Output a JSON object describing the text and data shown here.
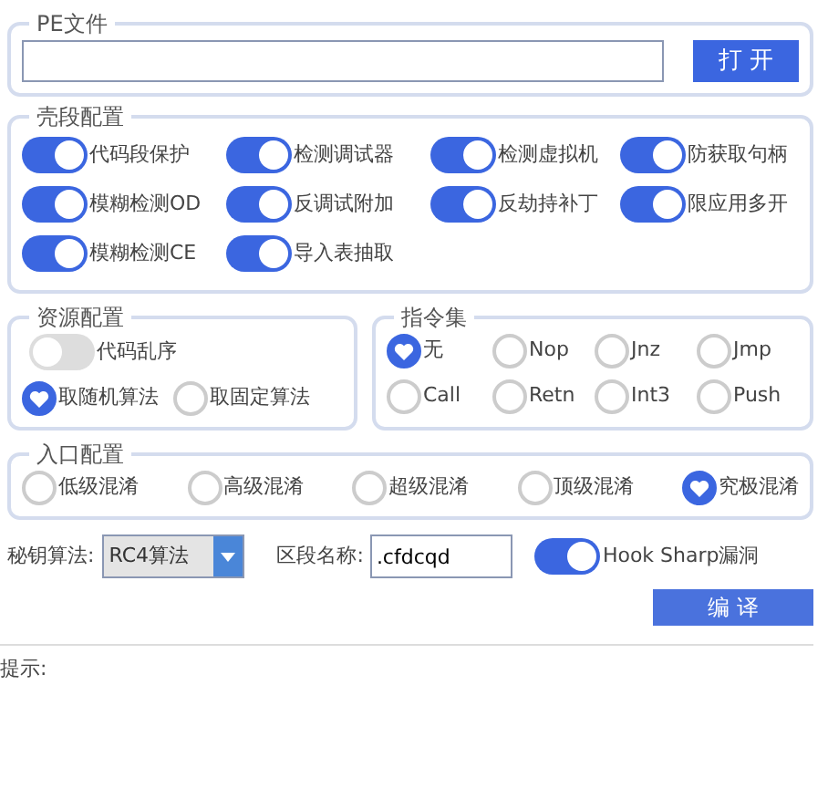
{
  "pe_file": {
    "legend": "PE文件",
    "button": "打 开"
  },
  "shell_config": {
    "legend": "壳段配置",
    "options": [
      {
        "label": "代码段保护",
        "on": true
      },
      {
        "label": "检测调试器",
        "on": true
      },
      {
        "label": "检测虚拟机",
        "on": true
      },
      {
        "label": "防获取句柄",
        "on": true
      },
      {
        "label": "模糊检测OD",
        "on": true
      },
      {
        "label": "反调试附加",
        "on": true
      },
      {
        "label": "反劫持补丁",
        "on": true
      },
      {
        "label": "限应用多开",
        "on": true
      },
      {
        "label": "模糊检测CE",
        "on": true
      },
      {
        "label": "导入表抽取",
        "on": true
      }
    ]
  },
  "resource_config": {
    "legend": "资源配置",
    "toggle": {
      "label": "代码乱序",
      "on": false
    },
    "algorithms": [
      {
        "label": "取随机算法",
        "selected": true
      },
      {
        "label": "取固定算法",
        "selected": false
      }
    ]
  },
  "instruction_set": {
    "legend": "指令集",
    "options": [
      {
        "label": "无",
        "selected": true
      },
      {
        "label": "Nop",
        "selected": false
      },
      {
        "label": "Jnz",
        "selected": false
      },
      {
        "label": "Jmp",
        "selected": false
      },
      {
        "label": "Call",
        "selected": false
      },
      {
        "label": "Retn",
        "selected": false
      },
      {
        "label": "Int3",
        "selected": false
      },
      {
        "label": "Push",
        "selected": false
      }
    ]
  },
  "entry_config": {
    "legend": "入口配置",
    "options": [
      {
        "label": "低级混淆",
        "selected": false
      },
      {
        "label": "高级混淆",
        "selected": false
      },
      {
        "label": "超级混淆",
        "selected": false
      },
      {
        "label": "顶级混淆",
        "selected": false
      },
      {
        "label": "究极混淆",
        "selected": true
      }
    ]
  },
  "key_algorithm": {
    "label": "秘钥算法:",
    "value": "RC4算法"
  },
  "section_name": {
    "label": "区段名称:",
    "value": ".cfdcqd"
  },
  "hook_sharp": {
    "label": "Hook Sharp漏洞",
    "on": true
  },
  "action_button": "编 译",
  "status": {
    "label": "提示:"
  }
}
